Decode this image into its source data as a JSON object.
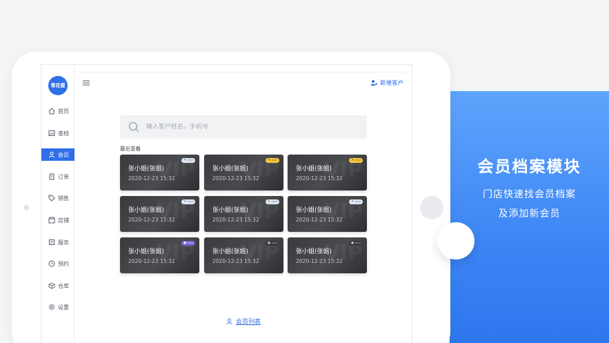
{
  "promo": {
    "title": "会员档案模块",
    "line1": "门店快速找会员档案",
    "line2": "及添加新会员"
  },
  "app": {
    "logo_text": "青花瓷",
    "add_customer": "新增客户",
    "search_placeholder": "输入客户姓名，手机号",
    "recent_label": "最近查看",
    "member_list_link": "会员列表"
  },
  "nav": [
    {
      "label": "首页",
      "icon": "home-icon"
    },
    {
      "label": "查档",
      "icon": "image-icon"
    },
    {
      "label": "会员",
      "icon": "user-icon",
      "active": true
    },
    {
      "label": "订单",
      "icon": "order-icon"
    },
    {
      "label": "销售",
      "icon": "tag-icon"
    },
    {
      "label": "店铺",
      "icon": "store-icon"
    },
    {
      "label": "服务",
      "icon": "service-icon"
    },
    {
      "label": "预约",
      "icon": "clock-icon"
    },
    {
      "label": "仓库",
      "icon": "box-icon"
    },
    {
      "label": "设置",
      "icon": "gear-icon"
    }
  ],
  "cards": [
    {
      "name": "张小姐(张姐)",
      "time": "2020-12-23  15:32",
      "badge": "silver"
    },
    {
      "name": "张小姐(张姐)",
      "time": "2020-12-23  15:32",
      "badge": "gold"
    },
    {
      "name": "张小姐(张姐)",
      "time": "2020-12-23  15:32",
      "badge": "gold"
    },
    {
      "name": "张小姐(张姐)",
      "time": "2020-12-23  15:32",
      "badge": "silver"
    },
    {
      "name": "张小姐(张姐)",
      "time": "2020-12-23  15:32",
      "badge": "silver"
    },
    {
      "name": "张小姐(张姐)",
      "time": "2020-12-23  15:32",
      "badge": "silver"
    },
    {
      "name": "张小姐(张姐)",
      "time": "2020-12-23  15:32",
      "badge": "purple"
    },
    {
      "name": "张小姐(张姐)",
      "time": "2020-12-23  15:32",
      "badge": "dark"
    },
    {
      "name": "张小姐(张姐)",
      "time": "2020-12-23  15:32",
      "badge": "dark"
    }
  ],
  "colors": {
    "accent": "#2f6fe8",
    "promo_blue": "#3e86f5",
    "card_dark": "#3a3b3e"
  }
}
